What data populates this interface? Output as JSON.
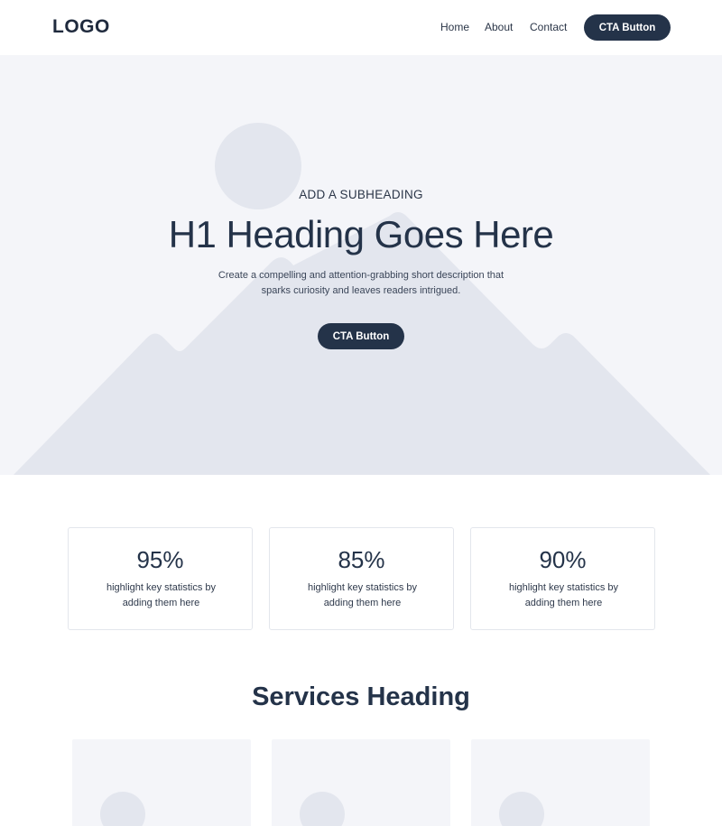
{
  "header": {
    "logo": "LOGO",
    "nav": [
      {
        "label": "Home"
      },
      {
        "label": "About"
      },
      {
        "label": "Contact"
      }
    ],
    "cta_label": "CTA Button"
  },
  "hero": {
    "subheading": "ADD A SUBHEADING",
    "title": "H1 Heading Goes Here",
    "description": "Create a compelling and attention-grabbing short description that sparks curiosity and leaves readers intrigued.",
    "cta_label": "CTA Button",
    "placeholder_icon": "image-placeholder-icon"
  },
  "stats": [
    {
      "value": "95%",
      "label": "highlight key statistics by adding them here"
    },
    {
      "value": "85%",
      "label": "highlight key statistics by adding them here"
    },
    {
      "value": "90%",
      "label": "highlight key statistics by adding them here"
    }
  ],
  "services": {
    "heading": "Services Heading"
  },
  "colors": {
    "primary": "#243349",
    "hero_bg": "#f4f5f9",
    "placeholder": "#e3e6ee",
    "text": "#1f2a3d"
  }
}
